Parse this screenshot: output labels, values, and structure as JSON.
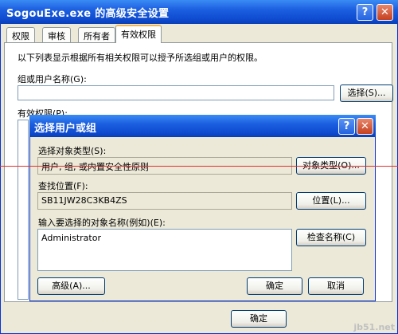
{
  "outer": {
    "title": "SogouExe.exe 的高级安全设置",
    "tabs": [
      "权限",
      "审核",
      "所有者",
      "有效权限"
    ],
    "description": "以下列表显示根据所有相关权限可以授予所选组或用户的权限。",
    "group_user_label": "组或用户名称(G):",
    "select_button": "选择(S)...",
    "effective_label": "有效权限(P):",
    "ok_button": "确定"
  },
  "dialog": {
    "title": "选择用户或组",
    "object_type_label": "选择对象类型(S):",
    "object_type_value": "用户, 组, 或内置安全性原则",
    "object_type_button": "对象类型(O)...",
    "location_label": "查找位置(F):",
    "location_value": "SB11JW28C3KB4ZS",
    "location_button": "位置(L)...",
    "names_label": "输入要选择的对象名称(例如)(E):",
    "names_value": "Administrator",
    "check_button": "检查名称(C)",
    "advanced_button": "高级(A)...",
    "ok_button": "确定",
    "cancel_button": "取消"
  },
  "watermark": "jb51.net"
}
